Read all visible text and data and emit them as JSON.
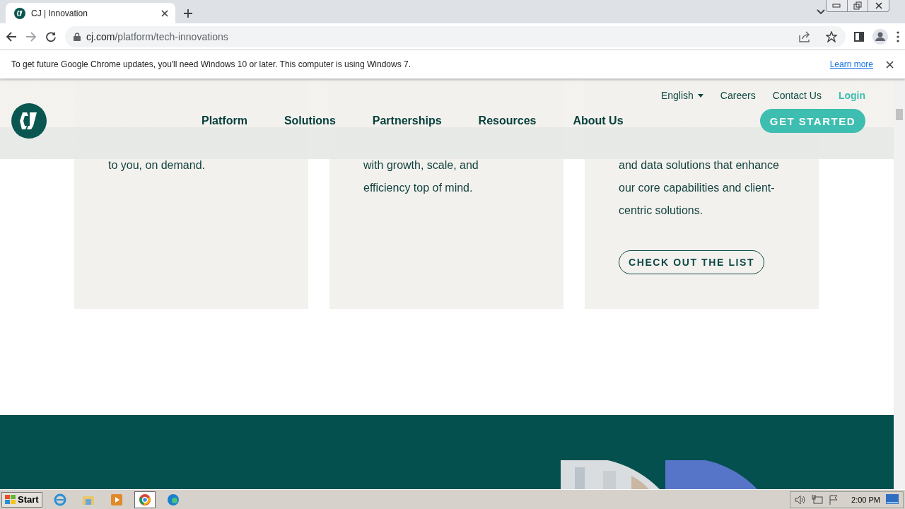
{
  "browser": {
    "tabs": [
      {
        "title": "CJ | Innovation",
        "selected": true
      }
    ],
    "address": {
      "host": "cj.com",
      "path": "/platform/tech-innovations"
    },
    "infobar": {
      "message": "To get future Google Chrome updates, you'll need Windows 10 or later. This computer is using Windows 7.",
      "link": "Learn more"
    }
  },
  "site_header": {
    "utility_links": [
      {
        "label": "English",
        "kind": "dropdown"
      },
      {
        "label": "Careers",
        "kind": "link"
      },
      {
        "label": "Contact Us",
        "kind": "link"
      },
      {
        "label": "Login",
        "kind": "login"
      }
    ],
    "nav": [
      "Platform",
      "Solutions",
      "Partnerships",
      "Resources",
      "About Us"
    ],
    "cta": "GET STARTED"
  },
  "cards": [
    {
      "text": "to you, on demand."
    },
    {
      "text": "with growth, scale, and\nefficiency top of mind."
    },
    {
      "text": "and data solutions that enhance\nour core capabilities and client-\ncentric solutions.",
      "button": "CHECK OUT THE LIST"
    }
  ],
  "taskbar": {
    "start": "Start",
    "apps": [
      {
        "kind": "ie",
        "selected": false
      },
      {
        "kind": "folder",
        "selected": false
      },
      {
        "kind": "media",
        "selected": false
      },
      {
        "kind": "chrome",
        "selected": true
      },
      {
        "kind": "edge",
        "selected": false
      }
    ],
    "time": "2:00 PM"
  }
}
